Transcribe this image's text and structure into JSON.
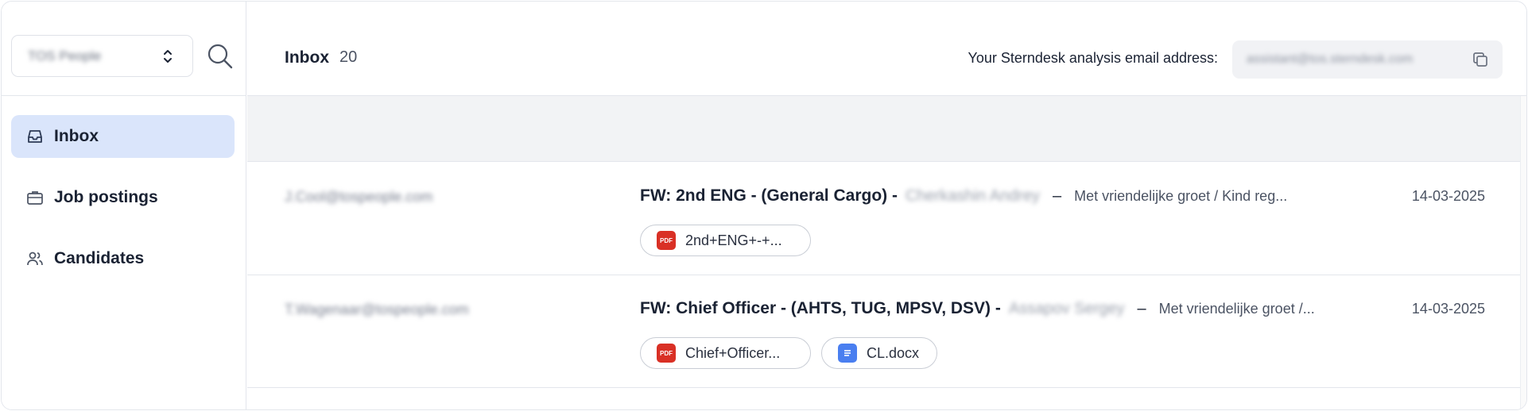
{
  "sidebar": {
    "org_select": {
      "value": "TOS People"
    },
    "items": [
      {
        "label": "Inbox",
        "icon": "inbox-icon",
        "active": true
      },
      {
        "label": "Job postings",
        "icon": "briefcase-icon",
        "active": false
      },
      {
        "label": "Candidates",
        "icon": "users-icon",
        "active": false
      }
    ]
  },
  "header": {
    "title": "Inbox",
    "count": "20",
    "email_label": "Your Sterndesk analysis email address:",
    "email_value": "assistant@tos.sterndesk.com"
  },
  "messages": [
    {
      "sender": "J.Cool@tospeople.com",
      "subject": "FW: 2nd ENG - (General Cargo) -",
      "candidate": "Cherkashin Andrey",
      "dash": "–",
      "preview": "Met vriendelijke groet / Kind reg...",
      "date": "14-03-2025",
      "attachments": [
        {
          "type": "pdf",
          "icon_text": "PDF",
          "name": "2nd+ENG+-+..."
        }
      ]
    },
    {
      "sender": "T.Wagenaar@tospeople.com",
      "subject": "FW: Chief Officer - (AHTS, TUG, MPSV, DSV) -",
      "candidate": "Assapov Sergey",
      "dash": "–",
      "preview": "Met vriendelijke groet /...",
      "date": "14-03-2025",
      "attachments": [
        {
          "type": "pdf",
          "icon_text": "PDF",
          "name": "Chief+Officer..."
        },
        {
          "type": "doc",
          "icon_text": "",
          "name": "CL.docx"
        }
      ]
    }
  ],
  "colors": {
    "active_nav_bg": "#dae5fb",
    "pdf_icon": "#d93025",
    "doc_icon": "#4a7ff0",
    "border": "#e3e6ec"
  }
}
